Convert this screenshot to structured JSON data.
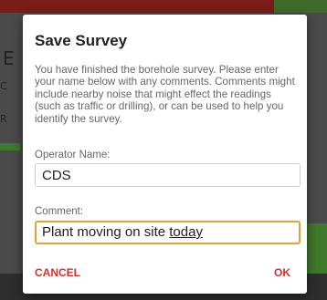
{
  "background": {
    "left_chars": [
      "E",
      "C",
      "R"
    ]
  },
  "dialog": {
    "title": "Save Survey",
    "message": "You have finished the borehole survey. Please enter your name below with any comments. Comments might include nearby noise that might effect the readings (such as traffic or drilling), or can be used to help you identify the survey.",
    "operator_label": "Operator Name:",
    "operator_value": "CDS",
    "comment_label": "Comment:",
    "comment_value_plain": "Plant moving on site ",
    "comment_value_underlined": "today",
    "cancel_label": "CANCEL",
    "ok_label": "OK"
  },
  "colors": {
    "accent": "#d32f2f",
    "focus_border": "#e0a33a"
  }
}
